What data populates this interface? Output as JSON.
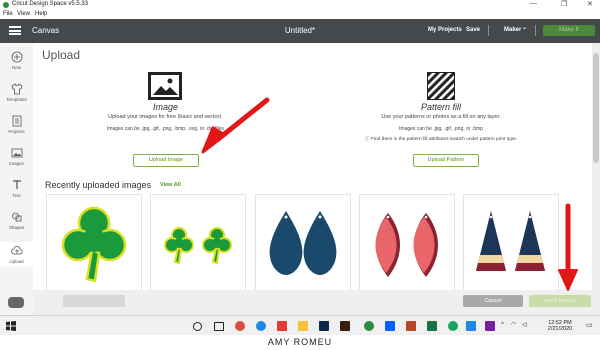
{
  "window": {
    "title": "Cricut Design Space  v5.5.33",
    "minimize": "—",
    "maximize": "❐",
    "close": "✕"
  },
  "menu": [
    "File",
    "View",
    "Help"
  ],
  "header": {
    "canvas": "Canvas",
    "document": "Untitled*",
    "my_projects": "My Projects",
    "save": "Save",
    "machine": "Maker",
    "machine_chevron": "⌄",
    "make_it": "Make It"
  },
  "sidebar": [
    {
      "label": "New",
      "icon": "plus-icon"
    },
    {
      "label": "Templates",
      "icon": "shirt-icon"
    },
    {
      "label": "Projects",
      "icon": "projects-icon"
    },
    {
      "label": "Images",
      "icon": "image-icon"
    },
    {
      "label": "Text",
      "icon": "text-icon"
    },
    {
      "label": "Shapes",
      "icon": "shapes-icon"
    },
    {
      "label": "Upload",
      "icon": "upload-icon"
    }
  ],
  "main": {
    "title": "Upload",
    "image_card": {
      "title": "Image",
      "subtitle": "Upload your images for free (basic and vector).",
      "formats": "Images can be .jpg, .gif, .png, .bmp, .svg, or .dxf files",
      "button": "Upload Image"
    },
    "pattern_card": {
      "title": "Pattern fill",
      "subtitle": "Use your patterns or photos as a fill on any layer.",
      "formats": "Images can be .jpg, .gif, .png, or .bmp",
      "note": "Find them in the pattern fill attributes swatch under pattern print type.",
      "button": "Upload Pattern"
    },
    "recent": {
      "title": "Recently uploaded images",
      "view_all": "View All"
    }
  },
  "footer": {
    "cancel": "Cancel",
    "insert": "Insert Images"
  },
  "taskbar": {
    "time": "12:52 PM",
    "date": "2/21/2020"
  },
  "credit": "AMY ROMEU",
  "colors": {
    "header": "#45494c",
    "accent_green": "#7cb342",
    "clover": "#1a9a3a",
    "clover_outline": "#d9e021",
    "teal": "#1a4a6b",
    "coral": "#e8666a",
    "navy": "#1d3556",
    "maroon": "#8b2332",
    "cream": "#f1d79f",
    "arrow": "#e11818"
  }
}
